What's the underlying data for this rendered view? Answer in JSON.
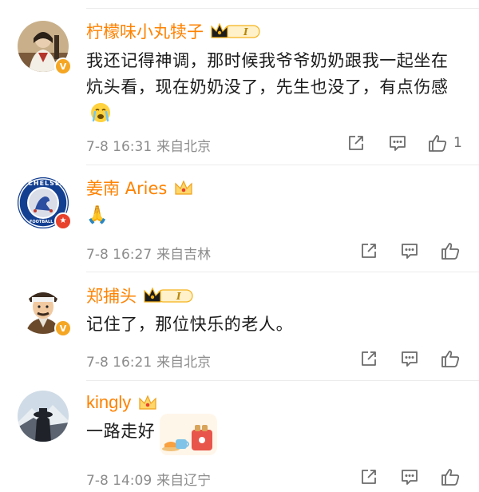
{
  "comments": [
    {
      "username": "柠檬味小丸犊子",
      "badge": "crown-level",
      "level": "I",
      "text": "我还记得神调，那时候我爷爷奶奶跟我一起坐在炕头看，现在奶奶没了，先生也没了，有点伤感",
      "emoji": "crying-face-emoji",
      "time": "7-8 16:31",
      "location": "来自北京",
      "likes": "1",
      "verified": "v-gold"
    },
    {
      "username": "姜南 Aries",
      "badge": "crown",
      "text": "🙏",
      "time": "7-8 16:27",
      "location": "来自吉林",
      "likes": "",
      "verified": "star-red",
      "avatar_text": "CHELSEA",
      "avatar_text2": "FOOTBALL C"
    },
    {
      "username": "郑捕头",
      "badge": "crown-level",
      "level": "I",
      "text": "记住了，那位快乐的老人。",
      "time": "7-8 16:21",
      "location": "来自北京",
      "likes": "",
      "verified": "v-gold"
    },
    {
      "username": "kingly",
      "badge": "crown",
      "text": "一路走好",
      "time": "7-8 14:09",
      "location": "来自辽宁",
      "likes": ""
    }
  ],
  "colors": {
    "name": "#ff8200",
    "meta": "#8c8c8c",
    "icon": "#6b6b6b",
    "gold": "#f5a623",
    "red": "#e8412c"
  }
}
